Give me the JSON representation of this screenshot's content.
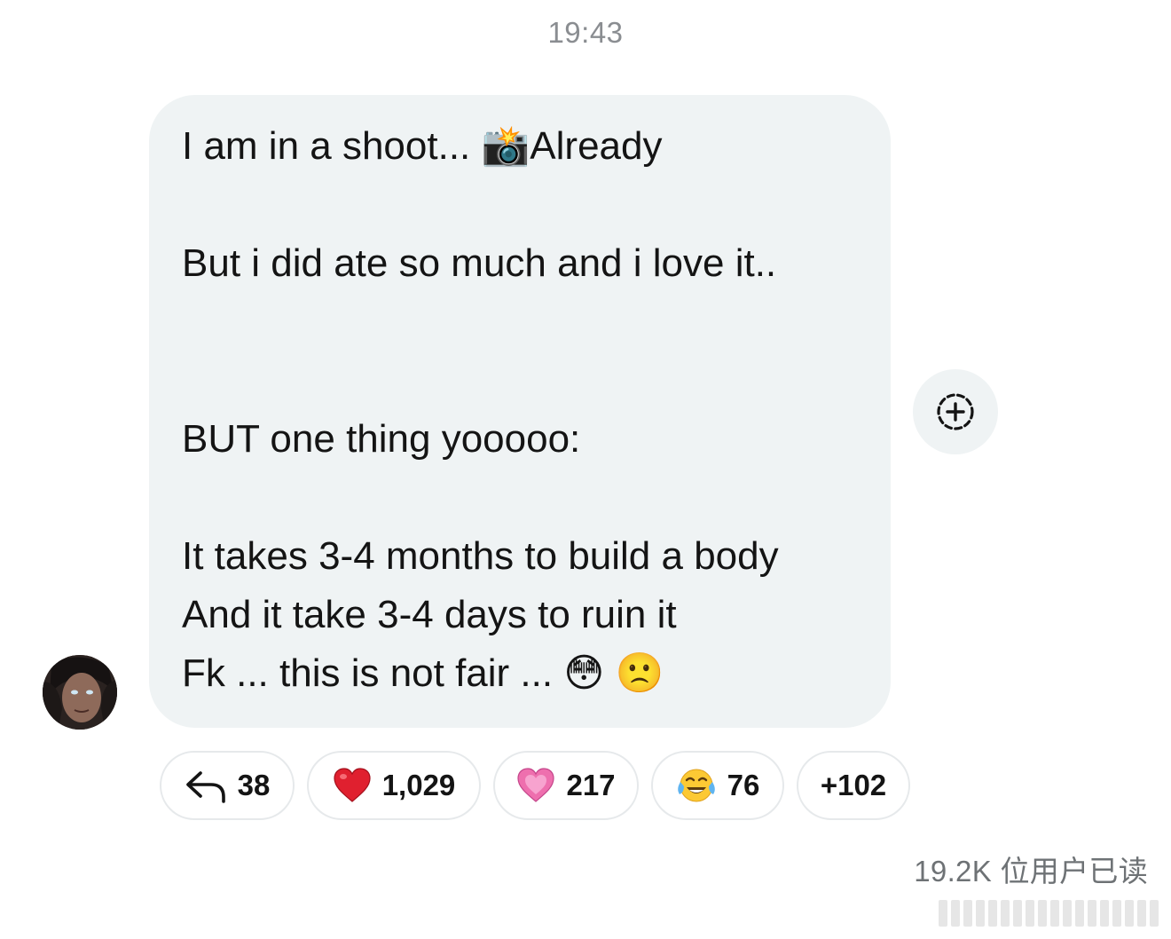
{
  "timestamp": "19:43",
  "message": {
    "lines": [
      {
        "text": "I am in a shoot... ",
        "emoji": "📸",
        "suffix": "Already"
      },
      {
        "text": "But i did ate so much and i love it.."
      },
      {
        "text": "BUT one thing yooooo:"
      },
      {
        "text": "It takes 3-4 months to build a body"
      },
      {
        "text": "And it take 3-4 days to ruin it"
      },
      {
        "text": "Fk ... this is not fair ... ",
        "emoji": "😳",
        "emoji2": "🙁"
      }
    ]
  },
  "avatar": {
    "icon": "user-avatar"
  },
  "add_reaction": {
    "icon": "add-reaction-icon"
  },
  "reactions": [
    {
      "icon": "reply-arrow-icon",
      "count": "38"
    },
    {
      "icon": "red-heart-icon",
      "emoji": "❤️",
      "count": "1,029"
    },
    {
      "icon": "pink-heart-icon",
      "emoji": "💗",
      "count": "217"
    },
    {
      "icon": "tears-of-joy-icon",
      "emoji": "😂",
      "count": "76"
    },
    {
      "label": "+102"
    }
  ],
  "read_receipt": "19.2K 位用户已读",
  "colors": {
    "bubble_bg": "#eff3f4",
    "timestamp": "#8a8d91",
    "heart_red": "#e0202f",
    "heart_pink": "#ee6fae"
  }
}
